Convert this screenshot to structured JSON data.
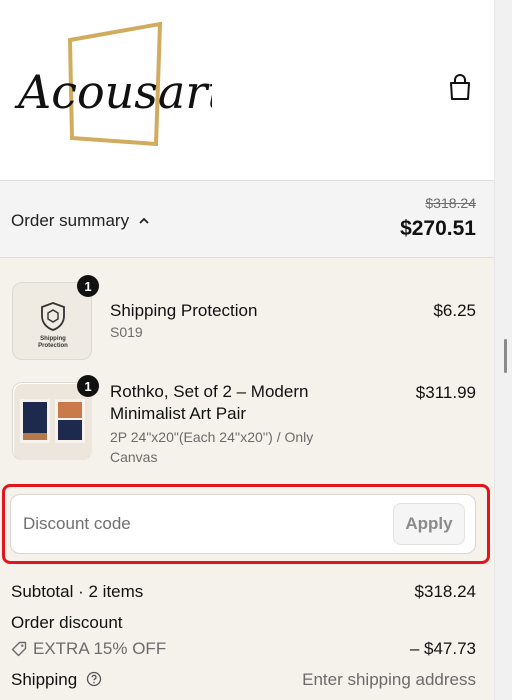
{
  "brand": {
    "logo_text": "Acousart"
  },
  "header": {
    "cart_icon": "shopping-bag-icon"
  },
  "summary": {
    "toggle_label": "Order summary",
    "toggle_icon": "chevron-up-icon",
    "original_total": "$318.24",
    "total": "$270.51"
  },
  "items": [
    {
      "title": "Shipping Protection",
      "subtitle": "S019",
      "price": "$6.25",
      "quantity": "1",
      "thumb_text": "Shipping Protection",
      "thumb_icon": "shield-box-icon"
    },
    {
      "title_line1": "Rothko, Set of 2 – Modern",
      "title_line2": "Minimalist Art Pair",
      "variant_line1": "2P 24\"x20\"(Each 24''x20'') / Only",
      "variant_line2": "Canvas",
      "price": "$311.99",
      "quantity": "1"
    }
  ],
  "discount": {
    "placeholder": "Discount code",
    "value": "",
    "apply_label": "Apply"
  },
  "totals": {
    "subtotal_label": "Subtotal · 2 items",
    "subtotal_value": "$318.24",
    "order_discount_label": "Order discount",
    "discount_code": "EXTRA 15% OFF",
    "discount_value": "– $47.73",
    "shipping_label": "Shipping",
    "shipping_value": "Enter shipping address"
  },
  "colors": {
    "highlight": "#e3141c",
    "body_bg": "#f5f2ec",
    "bar_bg": "#f4f4f4",
    "logo_gold": "#d1ac5e"
  }
}
